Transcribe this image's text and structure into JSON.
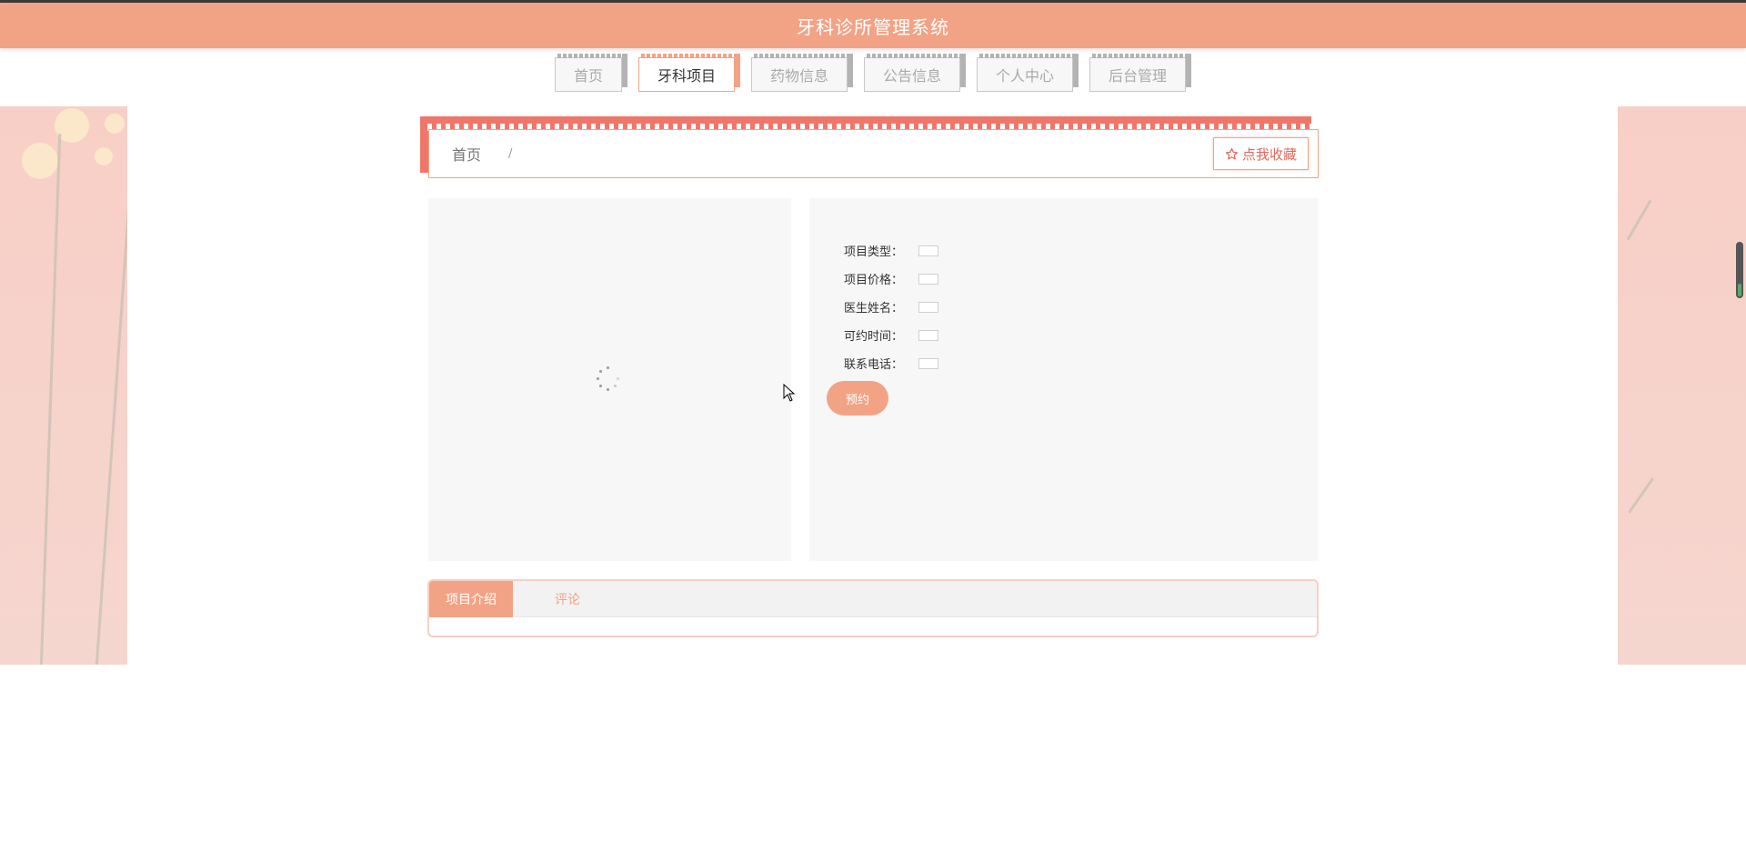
{
  "header": {
    "title": "牙科诊所管理系统"
  },
  "nav": {
    "items": [
      {
        "label": "首页"
      },
      {
        "label": "牙科项目",
        "active": true
      },
      {
        "label": "药物信息"
      },
      {
        "label": "公告信息"
      },
      {
        "label": "个人中心"
      },
      {
        "label": "后台管理"
      }
    ]
  },
  "breadcrumb": {
    "home": "首页",
    "separator": "/"
  },
  "favorite": {
    "icon": "star-outline-icon",
    "label": "点我收藏"
  },
  "details": {
    "fields": [
      {
        "label": "项目类型：",
        "value": ""
      },
      {
        "label": "项目价格：",
        "value": ""
      },
      {
        "label": "医生姓名：",
        "value": ""
      },
      {
        "label": "可约时间：",
        "value": ""
      },
      {
        "label": "联系电话：",
        "value": ""
      }
    ],
    "book_label": "预约"
  },
  "tabs": [
    {
      "label": "项目介绍",
      "active": true
    },
    {
      "label": "评论"
    }
  ],
  "colors": {
    "primary": "#f3a385",
    "accent": "#f0766a",
    "panel": "#f7f7f7"
  }
}
